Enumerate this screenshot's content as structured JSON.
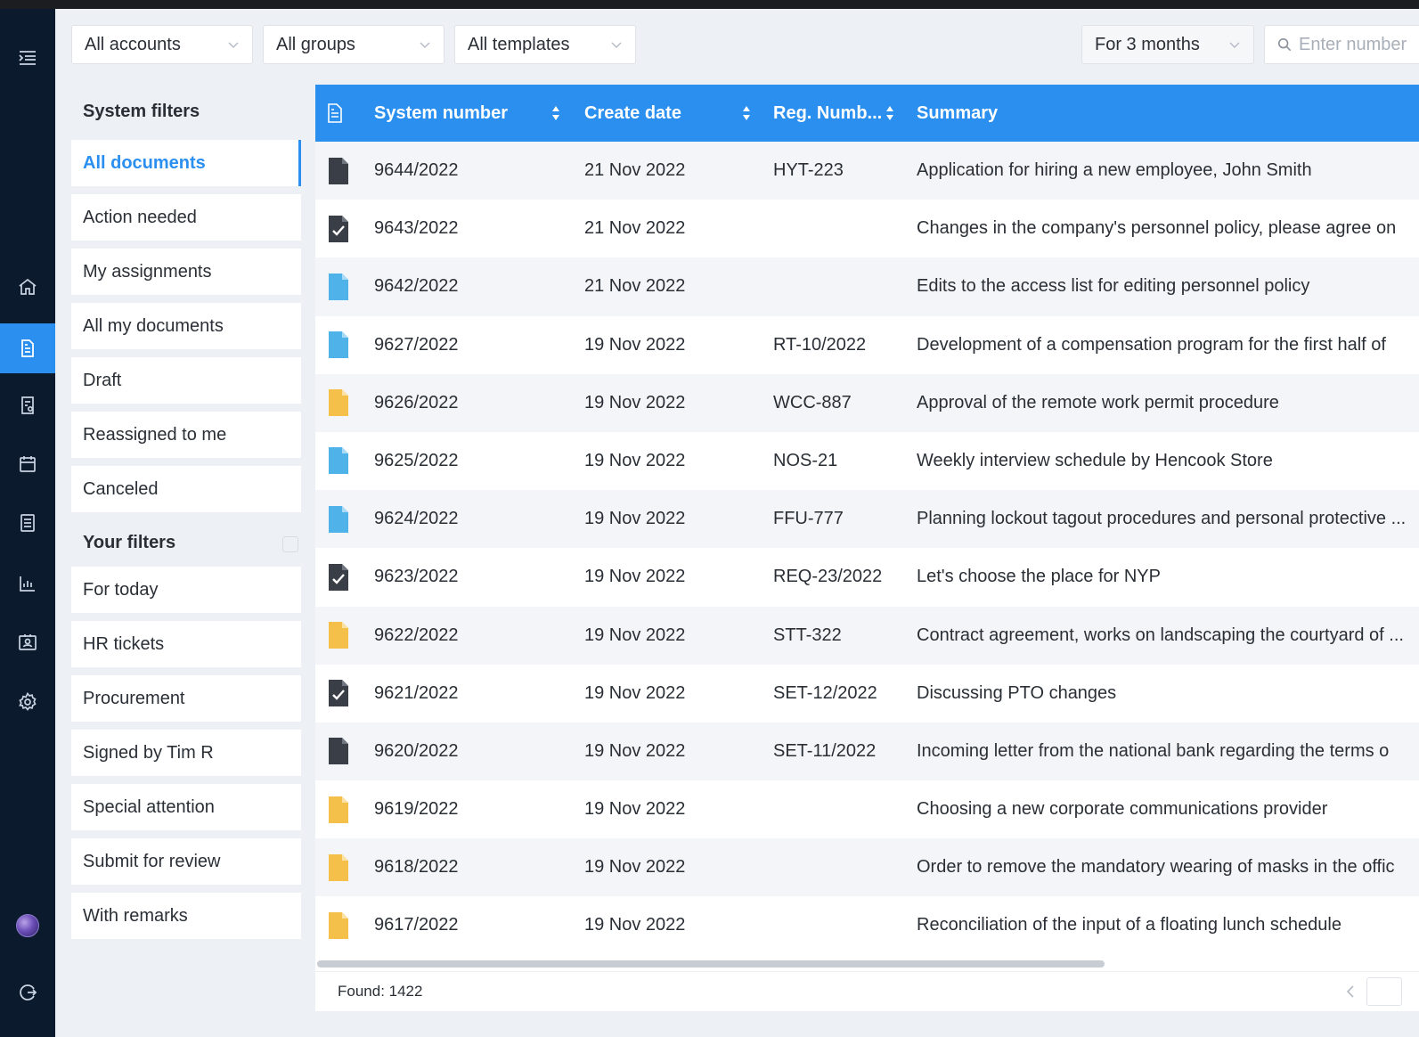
{
  "filters": {
    "accounts": "All accounts",
    "groups": "All groups",
    "templates": "All templates",
    "period": "For 3 months",
    "search_placeholder": "Enter number"
  },
  "sidebar": {
    "system_heading": "System filters",
    "system_items": [
      {
        "label": "All documents",
        "active": true
      },
      {
        "label": "Action needed"
      },
      {
        "label": "My assignments"
      },
      {
        "label": "All my documents"
      },
      {
        "label": "Draft"
      },
      {
        "label": "Reassigned to me"
      },
      {
        "label": "Canceled"
      }
    ],
    "your_heading": "Your filters",
    "your_items": [
      {
        "label": "For today"
      },
      {
        "label": "HR tickets"
      },
      {
        "label": "Procurement"
      },
      {
        "label": "Signed by Tim R"
      },
      {
        "label": "Special attention"
      },
      {
        "label": "Submit for review"
      },
      {
        "label": "With remarks"
      }
    ]
  },
  "table": {
    "columns": {
      "system_number": "System number",
      "create_date": "Create date",
      "reg_number": "Reg. Numb...",
      "summary": "Summary"
    },
    "rows": [
      {
        "icon": "document-dark-icon",
        "num": "9644/2022",
        "date": "21 Nov 2022",
        "reg": "HYT-223",
        "summary": "Application for hiring a new employee, John Smith"
      },
      {
        "icon": "document-check-icon",
        "num": "9643/2022",
        "date": "21 Nov 2022",
        "reg": "",
        "summary": "Changes in the company's personnel policy, please agree on"
      },
      {
        "icon": "document-blue-icon",
        "num": "9642/2022",
        "date": "21 Nov 2022",
        "reg": "",
        "summary": "Edits to the access list for editing personnel policy"
      },
      {
        "icon": "document-blue-icon",
        "num": "9627/2022",
        "date": "19 Nov 2022",
        "reg": "RT-10/2022",
        "summary": "Development of a compensation program for the first half of"
      },
      {
        "icon": "document-yellow-icon",
        "num": "9626/2022",
        "date": "19 Nov 2022",
        "reg": "WCC-887",
        "summary": "Approval of the remote work permit procedure"
      },
      {
        "icon": "document-blue-icon",
        "num": "9625/2022",
        "date": "19 Nov 2022",
        "reg": "NOS-21",
        "summary": "Weekly interview schedule by Hencook Store"
      },
      {
        "icon": "document-blue-icon",
        "num": "9624/2022",
        "date": "19 Nov 2022",
        "reg": "FFU-777",
        "summary": "Planning lockout tagout procedures and personal protective ..."
      },
      {
        "icon": "document-check-icon",
        "num": "9623/2022",
        "date": "19 Nov 2022",
        "reg": "REQ-23/2022",
        "summary": "Let's choose the place for NYP"
      },
      {
        "icon": "document-yellow-icon",
        "num": "9622/2022",
        "date": "19 Nov 2022",
        "reg": "STT-322",
        "summary": "Contract agreement, works on landscaping the courtyard of ..."
      },
      {
        "icon": "document-check-icon",
        "num": "9621/2022",
        "date": "19 Nov 2022",
        "reg": "SET-12/2022",
        "summary": "Discussing PTO changes"
      },
      {
        "icon": "document-dark-icon",
        "num": "9620/2022",
        "date": "19 Nov 2022",
        "reg": "SET-11/2022",
        "summary": "Incoming letter from the national bank regarding the terms o"
      },
      {
        "icon": "document-yellow-icon",
        "num": "9619/2022",
        "date": "19 Nov 2022",
        "reg": "",
        "summary": "Choosing a new corporate communications provider"
      },
      {
        "icon": "document-yellow-icon",
        "num": "9618/2022",
        "date": "19 Nov 2022",
        "reg": "",
        "summary": "Order to remove the mandatory wearing of masks in the offic"
      },
      {
        "icon": "document-yellow-icon",
        "num": "9617/2022",
        "date": "19 Nov 2022",
        "reg": "",
        "summary": "Reconciliation of the input of a floating lunch schedule"
      }
    ],
    "found": "Found: 1422"
  },
  "rail_icons": [
    "menu-collapse-icon",
    "home-icon",
    "documents-icon",
    "tasks-icon",
    "calendar-icon",
    "registry-icon",
    "reports-icon",
    "contacts-icon",
    "settings-icon",
    "avatar",
    "logout-icon"
  ],
  "colors": {
    "accent": "#2b8ff0",
    "rail": "#0c1a2e",
    "doc_dark": "#3a3f47",
    "doc_blue": "#4fb3ea",
    "doc_yellow": "#f5c04a"
  }
}
